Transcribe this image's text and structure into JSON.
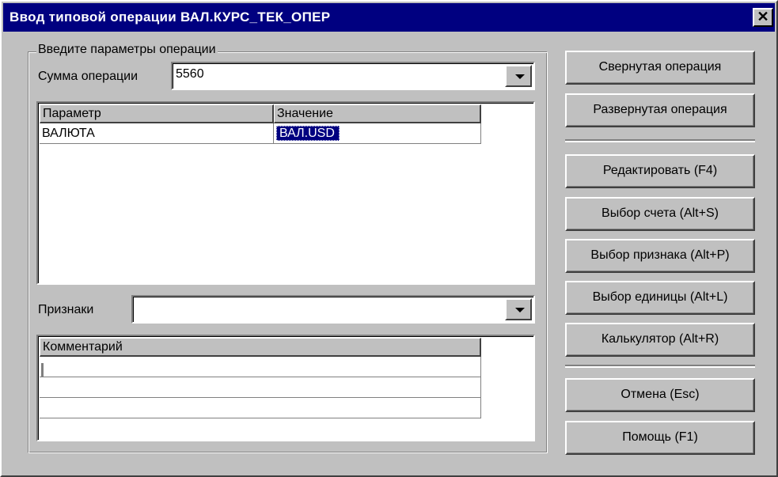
{
  "window": {
    "title": "Ввод типовой операции ВАЛ.КУРС_ТЕК_ОПЕР",
    "close_glyph": "✕"
  },
  "group": {
    "label": "Введите параметры операции"
  },
  "amount": {
    "label": "Сумма операции",
    "value": "5560"
  },
  "params_table": {
    "columns": [
      "Параметр",
      "Значение"
    ],
    "rows": [
      [
        "ВАЛЮТА",
        "ВАЛ.USD"
      ]
    ]
  },
  "attributes": {
    "label": "Признаки",
    "value": ""
  },
  "comments_table": {
    "header": "Комментарий",
    "rows": [
      "",
      "",
      ""
    ]
  },
  "buttons": {
    "collapsed": "Свернутая операция",
    "expanded": "Развернутая операция",
    "edit": "Редактировать (F4)",
    "select_account": "Выбор счета (Alt+S)",
    "select_attribute": "Выбор признака (Alt+P)",
    "select_unit": "Выбор единицы  (Alt+L)",
    "calculator": "Калькулятор  (Alt+R)",
    "cancel": "Отмена (Esc)",
    "help": "Помощь (F1)"
  },
  "colors": {
    "face": "#c0c0c0",
    "titlebar": "#000080",
    "selection": "#000080"
  },
  "icons": {
    "close": "close-icon",
    "dropdown": "chevron-down-icon"
  }
}
